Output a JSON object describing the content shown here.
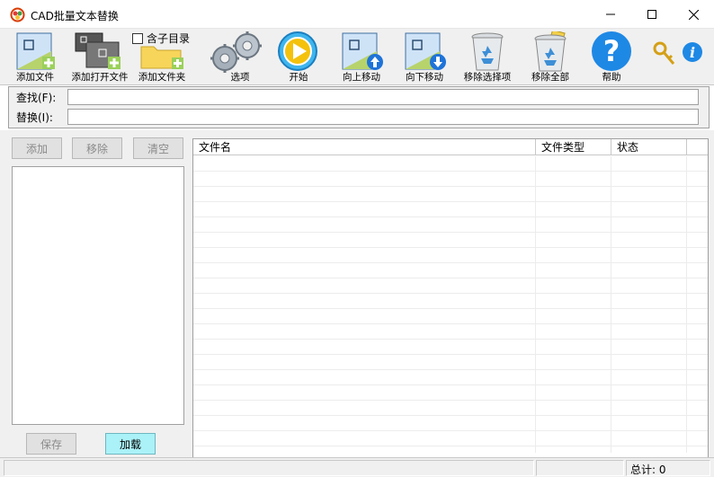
{
  "window": {
    "title": "CAD批量文本替换",
    "minimize_icon": "minimize-icon",
    "maximize_icon": "maximize-icon",
    "close_icon": "close-icon"
  },
  "toolbar": {
    "add_file": "添加文件",
    "add_opened_file": "添加打开文件",
    "include_subdir": "含子目录",
    "add_folder": "添加文件夹",
    "options": "选项",
    "start": "开始",
    "move_up": "向上移动",
    "move_down": "向下移动",
    "remove_selected": "移除选择项",
    "remove_all": "移除全部",
    "help": "帮助"
  },
  "search": {
    "find_label": "查找(F):",
    "find_value": "",
    "replace_label": "替换(I):",
    "replace_value": ""
  },
  "left_panel": {
    "add_button": "添加",
    "remove_button": "移除",
    "clear_button": "清空",
    "save_button": "保存",
    "load_button": "加载"
  },
  "table": {
    "columns": [
      "文件名",
      "文件类型",
      "状态"
    ],
    "rows": []
  },
  "status": {
    "total": "总计: 0"
  },
  "colors": {
    "accent_load": "#aaf2f8",
    "help_blue": "#1e88e5",
    "start_yellow": "#f4c20d"
  }
}
